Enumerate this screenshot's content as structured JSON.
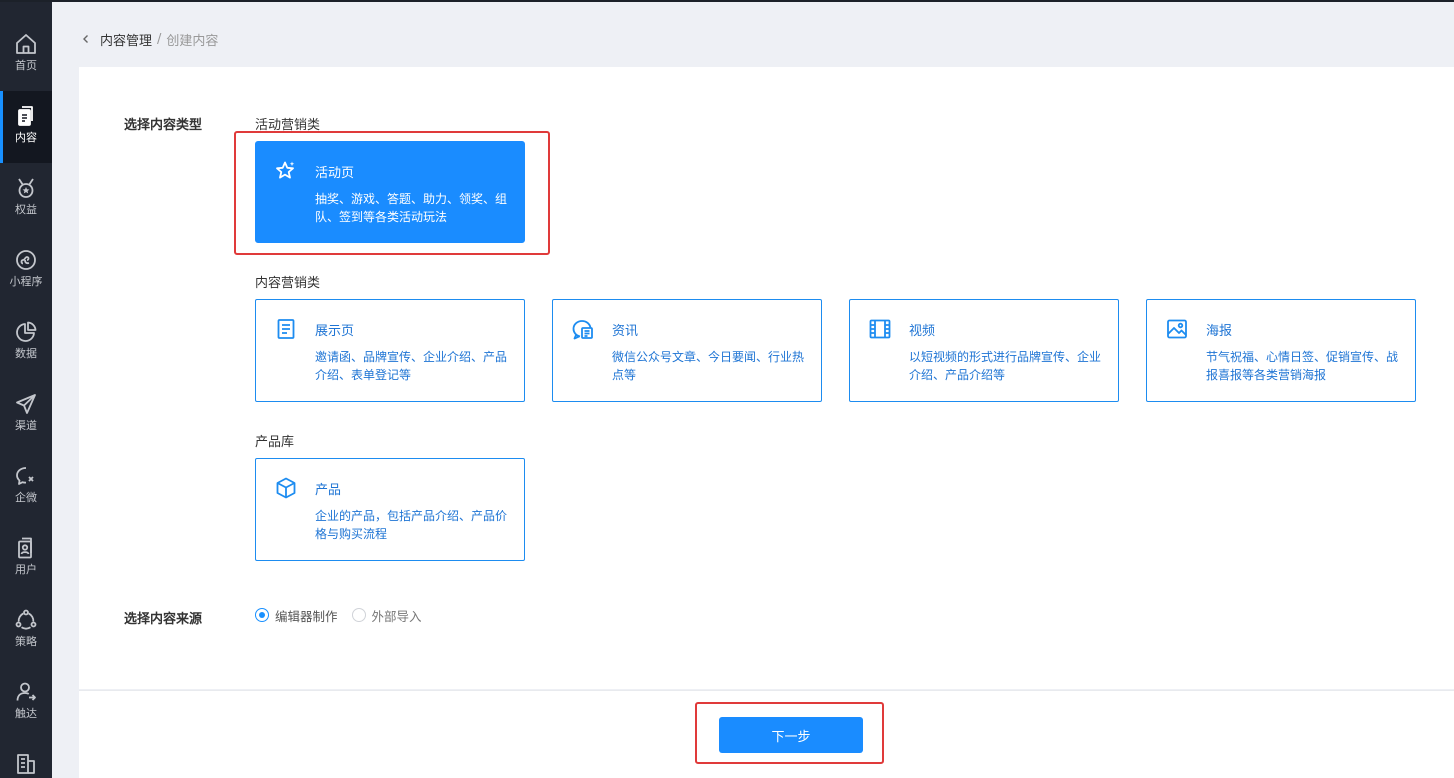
{
  "sidebar": {
    "items": [
      {
        "label": "首页",
        "icon": "home-icon"
      },
      {
        "label": "内容",
        "icon": "content-icon",
        "active": true
      },
      {
        "label": "权益",
        "icon": "medal-icon"
      },
      {
        "label": "小程序",
        "icon": "miniprogram-icon"
      },
      {
        "label": "数据",
        "icon": "pie-chart-icon"
      },
      {
        "label": "渠道",
        "icon": "send-icon"
      },
      {
        "label": "企微",
        "icon": "chat-icon"
      },
      {
        "label": "用户",
        "icon": "user-card-icon"
      },
      {
        "label": "策略",
        "icon": "strategy-icon"
      },
      {
        "label": "触达",
        "icon": "reach-icon"
      }
    ]
  },
  "breadcrumb": {
    "parent": "内容管理",
    "separator": "/",
    "current": "创建内容"
  },
  "content_type": {
    "label": "选择内容类型",
    "groups": [
      {
        "title": "活动营销类",
        "cards": [
          {
            "title": "活动页",
            "desc": "抽奖、游戏、答题、助力、领奖、组队、签到等各类活动玩法",
            "icon": "star-icon",
            "selected": true
          }
        ]
      },
      {
        "title": "内容营销类",
        "cards": [
          {
            "title": "展示页",
            "desc": "邀请函、品牌宣传、企业介绍、产品介绍、表单登记等",
            "icon": "document-icon"
          },
          {
            "title": "资讯",
            "desc": "微信公众号文章、今日要闻、行业热点等",
            "icon": "news-icon"
          },
          {
            "title": "视频",
            "desc": "以短视频的形式进行品牌宣传、企业介绍、产品介绍等",
            "icon": "film-icon"
          },
          {
            "title": "海报",
            "desc": "节气祝福、心情日签、促销宣传、战报喜报等各类营销海报",
            "icon": "image-icon"
          }
        ]
      },
      {
        "title": "产品库",
        "cards": [
          {
            "title": "产品",
            "desc": "企业的产品，包括产品介绍、产品价格与购买流程",
            "icon": "cube-icon"
          }
        ]
      }
    ]
  },
  "content_source": {
    "label": "选择内容来源",
    "options": [
      {
        "label": "编辑器制作",
        "checked": true
      },
      {
        "label": "外部导入",
        "checked": false
      }
    ]
  },
  "footer": {
    "next_label": "下一步"
  },
  "colors": {
    "sidebar_bg": "#212631",
    "primary": "#1a8cff",
    "highlight": "#e03a3a",
    "page_bg": "#eef0f5"
  }
}
